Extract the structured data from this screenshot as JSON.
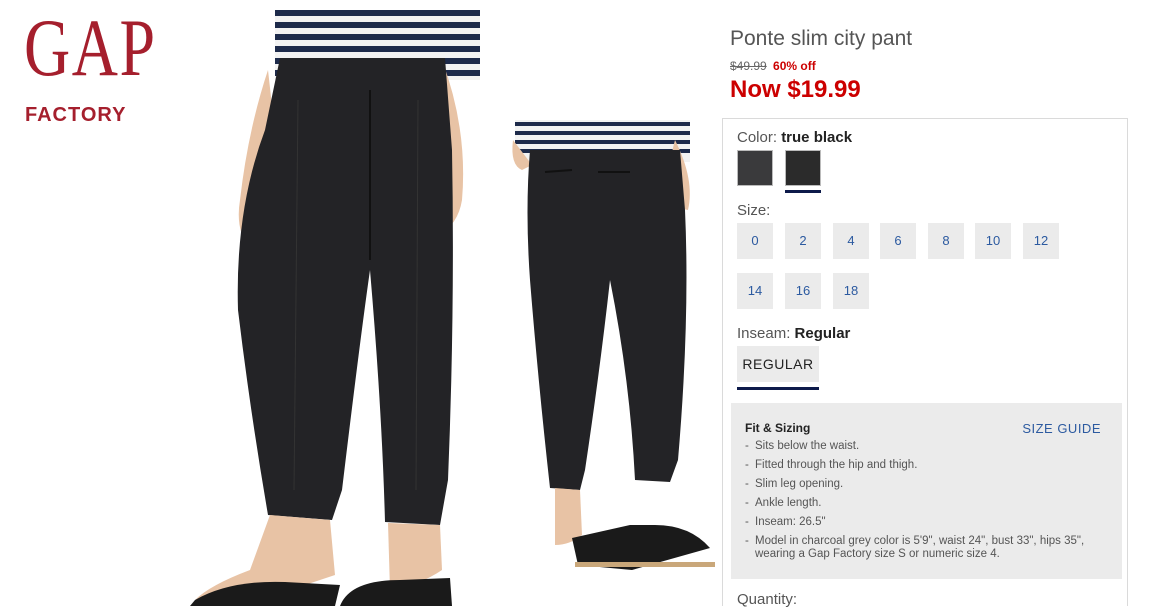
{
  "logo": {
    "line1": "GAP",
    "line2": "FACTORY"
  },
  "product": {
    "title": "Ponte slim city pant",
    "original_price": "$49.99",
    "discount": "60% off",
    "now_price": "Now $19.99"
  },
  "color": {
    "label": "Color:",
    "selected": "true black",
    "swatches": [
      {
        "name": "charcoal grey",
        "hex": "#3a3a3c"
      },
      {
        "name": "true black",
        "hex": "#2b2b2b"
      }
    ]
  },
  "size": {
    "label": "Size:",
    "options": [
      "0",
      "2",
      "4",
      "6",
      "8",
      "10",
      "12",
      "14",
      "16",
      "18"
    ]
  },
  "inseam": {
    "label": "Inseam:",
    "selected": "Regular",
    "button": "REGULAR"
  },
  "fit": {
    "title": "Fit & Sizing",
    "size_guide": "SIZE GUIDE",
    "items": [
      "Sits below the waist.",
      "Fitted through the hip and thigh.",
      "Slim leg opening.",
      "Ankle length.",
      "Inseam: 26.5\"",
      "Model in charcoal grey color is 5'9\", waist 24\", bust 33\", hips 35\", wearing a Gap Factory size S or numeric size 4."
    ]
  },
  "quantity": {
    "label": "Quantity:"
  },
  "colors": {
    "brand": "#a51f2d",
    "sale": "#cc0000",
    "link": "#2c5aa0",
    "selected_underline": "#0d1a4a"
  }
}
